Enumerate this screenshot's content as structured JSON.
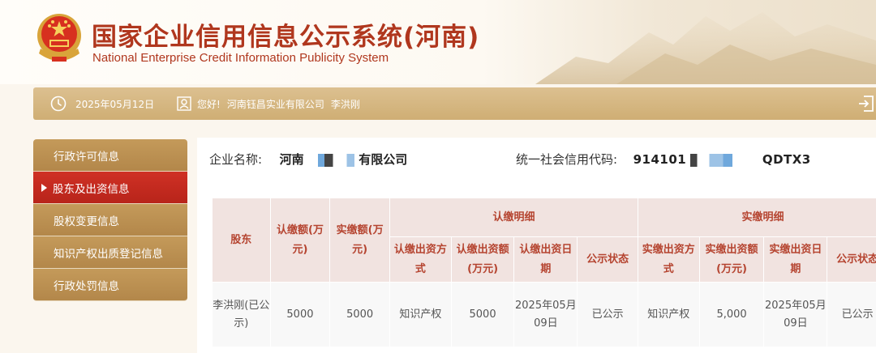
{
  "header": {
    "title_cn": "国家企业信用信息公示系统(河南)",
    "title_en": "National Enterprise Credit Information Publicity System"
  },
  "infobar": {
    "date": "2025年05月12日",
    "greeting": "您好!",
    "company": "河南钰昌实业有限公司",
    "user": "李洪刚"
  },
  "sidebar": {
    "items": [
      {
        "label": "行政许可信息",
        "active": false
      },
      {
        "label": "股东及出资信息",
        "active": true
      },
      {
        "label": "股权变更信息",
        "active": false
      },
      {
        "label": "知识产权出质登记信息",
        "active": false
      },
      {
        "label": "行政处罚信息",
        "active": false
      }
    ]
  },
  "company_info": {
    "name_label": "企业名称:",
    "name_prefix": "河南",
    "name_suffix": "有限公司",
    "credit_label": "统一社会信用代码:",
    "credit_prefix": "914101",
    "credit_suffix": "QDTX3"
  },
  "table": {
    "header_row1": {
      "shareholder": "股东",
      "subscribed": "认缴额(万元)",
      "paid": "实缴额(万元)",
      "subscribed_detail": "认缴明细",
      "paid_detail": "实缴明细"
    },
    "header_row2": [
      "认缴出资方式",
      "认缴出资额(万元)",
      "认缴出资日期",
      "公示状态",
      "实缴出资方式",
      "实缴出资额(万元)",
      "实缴出资日期",
      "公示状态"
    ],
    "rows": [
      [
        "李洪刚(已公示)",
        "5000",
        "5000",
        "知识产权",
        "5000",
        "2025年05月09日",
        "已公示",
        "知识产权",
        "5,000",
        "2025年05月09日",
        "已公示"
      ]
    ]
  }
}
